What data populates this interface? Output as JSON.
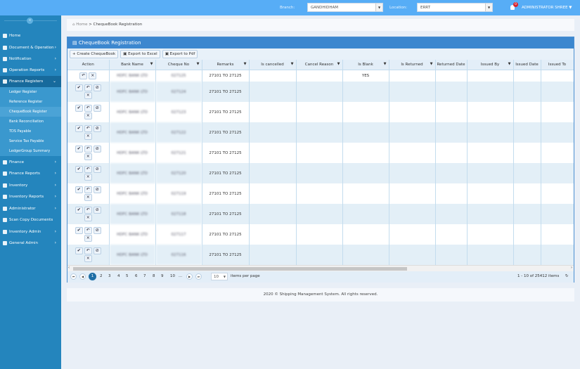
{
  "topbar": {
    "branch_label": "Branch:",
    "branch_value": "GANDHIDHAM",
    "location_label": "Location:",
    "location_value": "ERRT",
    "notifications": "0",
    "user": "ADMINISTRATOR SHREE"
  },
  "sidebar": {
    "items": [
      {
        "label": "Home",
        "chev": ""
      },
      {
        "label": "Document & Operation",
        "chev": "›"
      },
      {
        "label": "Notification",
        "chev": "›"
      },
      {
        "label": "Operation Reports",
        "chev": "›"
      },
      {
        "label": "Finance Registers",
        "chev": "⌄"
      },
      {
        "label": "Finance",
        "chev": "›"
      },
      {
        "label": "Finance Reports",
        "chev": "›"
      },
      {
        "label": "Inventory",
        "chev": "›"
      },
      {
        "label": "Inventory Reports",
        "chev": "›"
      },
      {
        "label": "Administrator",
        "chev": "›"
      },
      {
        "label": "Scan Copy Documents",
        "chev": ""
      },
      {
        "label": "Inventory Admin",
        "chev": "›"
      },
      {
        "label": "General Admin",
        "chev": "›"
      }
    ],
    "subitems": [
      "Ledger Register",
      "Reference Register",
      "ChequeBook Register",
      "Bank Reconciliation",
      "TDS Payable",
      "Service Tax Payable",
      "LedgerGroup Summary"
    ]
  },
  "breadcrumb": {
    "home": "Home",
    "sep": ">",
    "current": "ChequeBook Registration"
  },
  "panel": {
    "title": "ChequeBook Registration",
    "create": "+ Create ChequeBook",
    "excel": "Export to Excel",
    "pdf": "Export to Pdf"
  },
  "table": {
    "columns": [
      "Action",
      "Bank Name",
      "Cheque No",
      "Remarks",
      "Is cancelled",
      "Cancel Reason",
      "Is Blank",
      "Is Returned",
      "Returned Date",
      "Issued By",
      "Issued Date",
      "Issued To"
    ],
    "rows": [
      {
        "bank": "HDFC BANK LTD",
        "cheque": "027125",
        "remarks": "27101 TO 27125",
        "blank": "YES"
      },
      {
        "bank": "HDFC BANK LTD",
        "cheque": "027124",
        "remarks": "27101 TO 27125",
        "blank": ""
      },
      {
        "bank": "HDFC BANK LTD",
        "cheque": "027123",
        "remarks": "27101 TO 27125",
        "blank": ""
      },
      {
        "bank": "HDFC BANK LTD",
        "cheque": "027122",
        "remarks": "27101 TO 27125",
        "blank": ""
      },
      {
        "bank": "HDFC BANK LTD",
        "cheque": "027121",
        "remarks": "27101 TO 27125",
        "blank": ""
      },
      {
        "bank": "HDFC BANK LTD",
        "cheque": "027120",
        "remarks": "27101 TO 27125",
        "blank": ""
      },
      {
        "bank": "HDFC BANK LTD",
        "cheque": "027119",
        "remarks": "27101 TO 27125",
        "blank": ""
      },
      {
        "bank": "HDFC BANK LTD",
        "cheque": "027118",
        "remarks": "27101 TO 27125",
        "blank": ""
      },
      {
        "bank": "HDFC BANK LTD",
        "cheque": "027117",
        "remarks": "27101 TO 27125",
        "blank": ""
      },
      {
        "bank": "HDFC BANK LTD",
        "cheque": "027116",
        "remarks": "27101 TO 27125",
        "blank": ""
      }
    ]
  },
  "pager": {
    "pages": [
      "1",
      "2",
      "3",
      "4",
      "5",
      "6",
      "7",
      "8",
      "9",
      "10",
      "..."
    ],
    "page_size": "10",
    "per_page_label": "items per page",
    "summary": "1 - 10 of 25412 items"
  },
  "footer": "2020 © Shipping Management System. All rights reserved."
}
